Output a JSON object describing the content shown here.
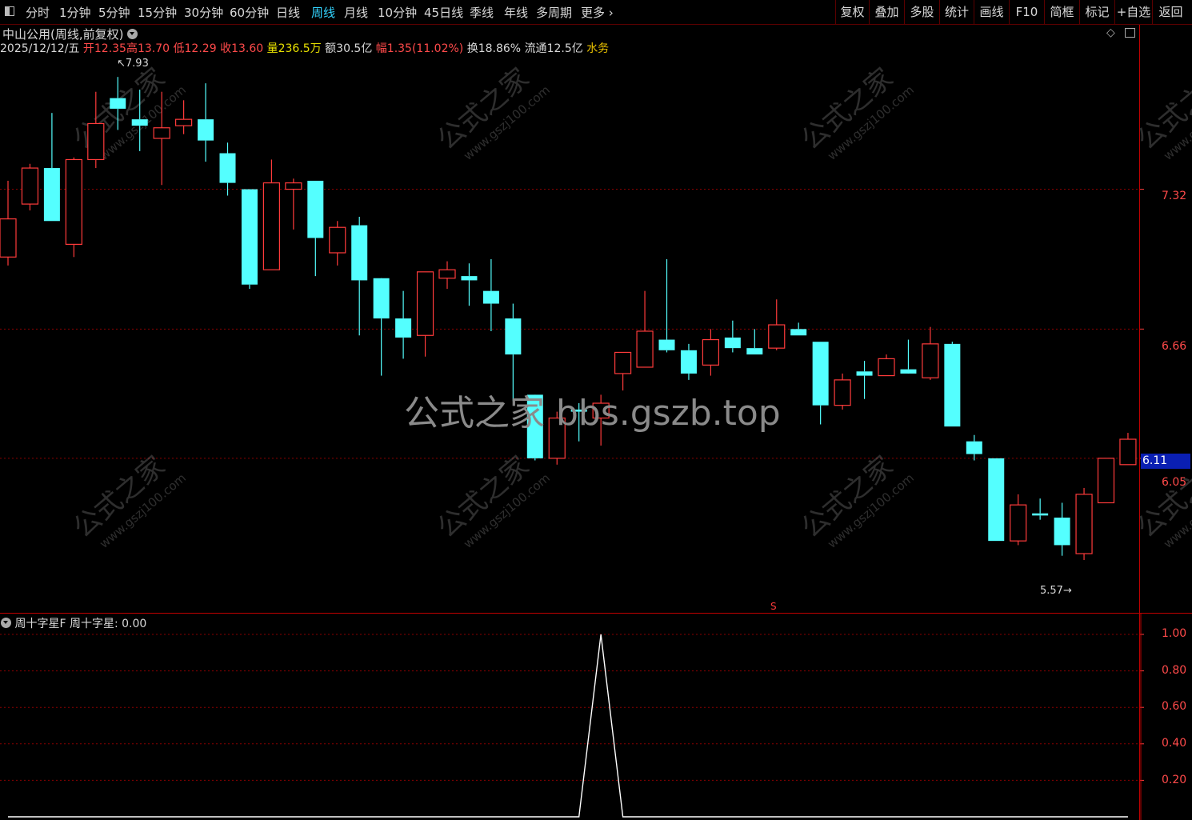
{
  "toolbar": {
    "tabs": [
      "分时",
      "1分钟",
      "5分钟",
      "15分钟",
      "30分钟",
      "60分钟",
      "日线",
      "周线",
      "月线",
      "10分钟",
      "45日线",
      "季线",
      "年线",
      "多周期",
      "更多"
    ],
    "more_chevron": "›",
    "active_tab_index": 7,
    "right_buttons": [
      "复权",
      "叠加",
      "多股",
      "统计",
      "画线",
      "F10",
      "简框",
      "标记",
      "+自选",
      "返回"
    ]
  },
  "header": {
    "stock_name": "中山公用",
    "period_desc": "(周线,前复权)",
    "date": "2025/12/12/五",
    "open_label": "开",
    "open": "12.35",
    "high_label": "高",
    "high": "13.70",
    "low_label": "低",
    "low": "12.29",
    "close_label": "收",
    "close": "13.60",
    "volume_label": "量",
    "volume": "236.5万",
    "amount_label": "额",
    "amount": "30.5亿",
    "range_label": "幅",
    "range": "1.35(11.02%)",
    "turnover_label": "换",
    "turnover": "18.86%",
    "float_label": "流通",
    "float_cap": "12.5亿",
    "sector": "水务"
  },
  "price_axis": {
    "labels": [
      "7.32",
      "6.66",
      "6.05"
    ],
    "current_price": "6.11"
  },
  "annotations": {
    "high_marker": "7.93",
    "low_marker": "5.57",
    "s_marker": "S"
  },
  "watermark": {
    "center_text": "公式之家 bbs.gszb.top",
    "diagonal_text": "公式之家",
    "diagonal_url": "www.gszj100.com"
  },
  "indicator": {
    "name": "周十字星F",
    "value_label": "周十字星",
    "value": "0.00",
    "axis_labels": [
      "1.00",
      "0.80",
      "0.60",
      "0.40",
      "0.20"
    ]
  },
  "colors": {
    "up": "#ff3b3b",
    "down": "#54ffff",
    "grid": "#8a0000",
    "doji": "#ffffff"
  },
  "chart_data": {
    "type": "candlestick",
    "ylim": [
      5.4,
      7.93
    ],
    "candles": [
      {
        "o": 7.0,
        "h": 7.36,
        "l": 6.96,
        "c": 7.18
      },
      {
        "o": 7.25,
        "h": 7.44,
        "l": 7.22,
        "c": 7.42
      },
      {
        "o": 7.42,
        "h": 7.68,
        "l": 7.17,
        "c": 7.17
      },
      {
        "o": 7.06,
        "h": 7.47,
        "l": 7.0,
        "c": 7.46
      },
      {
        "o": 7.46,
        "h": 7.78,
        "l": 7.42,
        "c": 7.63
      },
      {
        "o": 7.75,
        "h": 7.85,
        "l": 7.6,
        "c": 7.7
      },
      {
        "o": 7.65,
        "h": 7.79,
        "l": 7.5,
        "c": 7.62
      },
      {
        "o": 7.56,
        "h": 7.78,
        "l": 7.34,
        "c": 7.61
      },
      {
        "o": 7.62,
        "h": 7.74,
        "l": 7.58,
        "c": 7.65
      },
      {
        "o": 7.65,
        "h": 7.82,
        "l": 7.45,
        "c": 7.55
      },
      {
        "o": 7.49,
        "h": 7.54,
        "l": 7.29,
        "c": 7.35
      },
      {
        "o": 7.32,
        "h": 7.32,
        "l": 6.85,
        "c": 6.87
      },
      {
        "o": 6.94,
        "h": 7.46,
        "l": 6.94,
        "c": 7.35
      },
      {
        "o": 7.32,
        "h": 7.37,
        "l": 7.13,
        "c": 7.35
      },
      {
        "o": 7.36,
        "h": 7.36,
        "l": 6.91,
        "c": 7.09
      },
      {
        "o": 7.02,
        "h": 7.17,
        "l": 6.96,
        "c": 7.14
      },
      {
        "o": 7.15,
        "h": 7.19,
        "l": 6.63,
        "c": 6.89
      },
      {
        "o": 6.9,
        "h": 6.86,
        "l": 6.44,
        "c": 6.71
      },
      {
        "o": 6.71,
        "h": 6.84,
        "l": 6.52,
        "c": 6.62
      },
      {
        "o": 6.63,
        "h": 6.93,
        "l": 6.53,
        "c": 6.93
      },
      {
        "o": 6.9,
        "h": 6.98,
        "l": 6.85,
        "c": 6.94
      },
      {
        "o": 6.91,
        "h": 6.97,
        "l": 6.77,
        "c": 6.89
      },
      {
        "o": 6.84,
        "h": 6.99,
        "l": 6.65,
        "c": 6.78
      },
      {
        "o": 6.71,
        "h": 6.78,
        "l": 6.32,
        "c": 6.54
      },
      {
        "o": 6.35,
        "h": 6.34,
        "l": 6.04,
        "c": 6.05
      },
      {
        "o": 6.05,
        "h": 6.27,
        "l": 6.02,
        "c": 6.24
      },
      {
        "o": 6.28,
        "h": 6.31,
        "l": 6.13,
        "c": 6.27
      },
      {
        "o": 6.24,
        "h": 6.35,
        "l": 6.11,
        "c": 6.31
      },
      {
        "o": 6.45,
        "h": 6.53,
        "l": 6.37,
        "c": 6.55
      },
      {
        "o": 6.48,
        "h": 6.84,
        "l": 6.5,
        "c": 6.65
      },
      {
        "o": 6.61,
        "h": 6.99,
        "l": 6.55,
        "c": 6.56
      },
      {
        "o": 6.56,
        "h": 6.59,
        "l": 6.42,
        "c": 6.45
      },
      {
        "o": 6.49,
        "h": 6.66,
        "l": 6.44,
        "c": 6.61
      },
      {
        "o": 6.62,
        "h": 6.7,
        "l": 6.55,
        "c": 6.57
      },
      {
        "o": 6.57,
        "h": 6.66,
        "l": 6.54,
        "c": 6.54
      },
      {
        "o": 6.57,
        "h": 6.8,
        "l": 6.56,
        "c": 6.68
      },
      {
        "o": 6.66,
        "h": 6.69,
        "l": 6.63,
        "c": 6.63
      },
      {
        "o": 6.6,
        "h": 6.6,
        "l": 6.21,
        "c": 6.3
      },
      {
        "o": 6.3,
        "h": 6.45,
        "l": 6.28,
        "c": 6.42
      },
      {
        "o": 6.46,
        "h": 6.51,
        "l": 6.33,
        "c": 6.44
      },
      {
        "o": 6.44,
        "h": 6.54,
        "l": 6.46,
        "c": 6.52
      },
      {
        "o": 6.47,
        "h": 6.61,
        "l": 6.46,
        "c": 6.45
      },
      {
        "o": 6.43,
        "h": 6.67,
        "l": 6.42,
        "c": 6.59
      },
      {
        "o": 6.59,
        "h": 6.6,
        "l": 6.2,
        "c": 6.2
      },
      {
        "o": 6.13,
        "h": 6.16,
        "l": 6.04,
        "c": 6.07
      },
      {
        "o": 6.05,
        "h": 6.05,
        "l": 5.66,
        "c": 5.66
      },
      {
        "o": 5.66,
        "h": 5.88,
        "l": 5.64,
        "c": 5.83
      },
      {
        "o": 5.79,
        "h": 5.86,
        "l": 5.76,
        "c": 5.78
      },
      {
        "o": 5.77,
        "h": 5.84,
        "l": 5.59,
        "c": 5.64
      },
      {
        "o": 5.6,
        "h": 5.91,
        "l": 5.57,
        "c": 5.88
      },
      {
        "o": 5.84,
        "h": 6.05,
        "l": 5.84,
        "c": 6.05
      },
      {
        "o": 6.02,
        "h": 6.17,
        "l": 6.05,
        "c": 6.14
      }
    ],
    "indicator_series": {
      "name": "周十字星",
      "ylim": [
        0,
        1.0
      ],
      "values": [
        0,
        0,
        0,
        0,
        0,
        0,
        0,
        0,
        0,
        0,
        0,
        0,
        0,
        0,
        0,
        0,
        0,
        0,
        0,
        0,
        0,
        0,
        0,
        0,
        0,
        0,
        0,
        1,
        0,
        0,
        0,
        0,
        0,
        0,
        0,
        0,
        0,
        0,
        0,
        0,
        0,
        0,
        0,
        0,
        0,
        0,
        0,
        0,
        0,
        0,
        0,
        0
      ]
    }
  }
}
